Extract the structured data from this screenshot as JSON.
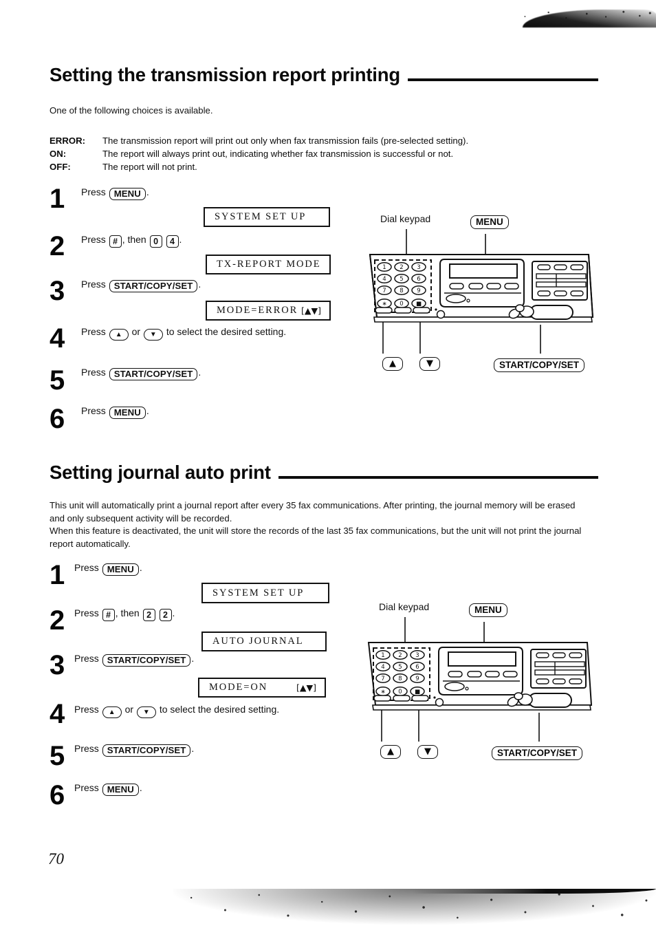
{
  "page": {
    "number": "70"
  },
  "sections": [
    {
      "heading": "Setting the transmission report printing",
      "intro": "One of the following choices is available.",
      "definitions": [
        {
          "term": "ERROR:",
          "desc": "The transmission report will print out only when fax transmission fails (pre-selected setting)."
        },
        {
          "term": "ON:",
          "desc": "The report will always print out, indicating whether fax transmission is successful or not."
        },
        {
          "term": "OFF:",
          "desc": "The report will not print."
        }
      ],
      "steps": [
        {
          "num": "1",
          "press": "Press",
          "key": "MENU",
          "tail": "."
        },
        {
          "num": "2",
          "press": "Press",
          "key": "#",
          "mid": ", then",
          "digits": [
            "0",
            "4"
          ],
          "tail": "."
        },
        {
          "num": "3",
          "press": "Press",
          "key": "START/COPY/SET",
          "tail": "."
        },
        {
          "num": "4",
          "press": "Press",
          "key_up": "▲",
          "or": "or",
          "key_down": "▼",
          "tail": "to select the desired setting."
        },
        {
          "num": "5",
          "press": "Press",
          "key": "START/COPY/SET",
          "tail": "."
        },
        {
          "num": "6",
          "press": "Press",
          "key": "MENU",
          "tail": "."
        }
      ],
      "lcds": [
        {
          "text": "SYSTEM SET UP",
          "arrows": ""
        },
        {
          "text": "TX-REPORT MODE",
          "arrows": ""
        },
        {
          "text": "MODE=ERROR",
          "arrows": "[▲▼]"
        }
      ],
      "diagram": {
        "dial_keypad_label": "Dial keypad",
        "menu_callout": "MENU",
        "start_callout": "START/COPY/SET",
        "up_callout": "▲",
        "down_callout": "▼",
        "keys": [
          "1",
          "2",
          "3",
          "4",
          "5",
          "6",
          "7",
          "8",
          "9",
          "∗",
          "0",
          "■"
        ]
      }
    },
    {
      "heading": "Setting journal auto print",
      "intro": "This unit will automatically print a journal report after every 35 fax communications. After printing, the journal memory will be erased and only subsequent activity will be recorded.\nWhen this feature is deactivated, the unit will store the records of the last 35 fax communications, but the unit will not print the journal report automatically.",
      "steps": [
        {
          "num": "1",
          "press": "Press",
          "key": "MENU",
          "tail": "."
        },
        {
          "num": "2",
          "press": "Press",
          "key": "#",
          "mid": ", then",
          "digits": [
            "2",
            "2"
          ],
          "tail": "."
        },
        {
          "num": "3",
          "press": "Press",
          "key": "START/COPY/SET",
          "tail": "."
        },
        {
          "num": "4",
          "press": "Press",
          "key_up": "▲",
          "or": "or",
          "key_down": "▼",
          "tail": "to select the desired setting."
        },
        {
          "num": "5",
          "press": "Press",
          "key": "START/COPY/SET",
          "tail": "."
        },
        {
          "num": "6",
          "press": "Press",
          "key": "MENU",
          "tail": "."
        }
      ],
      "lcds": [
        {
          "text": "SYSTEM SET UP",
          "arrows": ""
        },
        {
          "text": "AUTO JOURNAL",
          "arrows": ""
        },
        {
          "text": "MODE=ON",
          "arrows": "[▲▼]"
        }
      ],
      "diagram": {
        "dial_keypad_label": "Dial keypad",
        "menu_callout": "MENU",
        "start_callout": "START/COPY/SET",
        "up_callout": "▲",
        "down_callout": "▼",
        "keys": [
          "1",
          "2",
          "3",
          "4",
          "5",
          "6",
          "7",
          "8",
          "9",
          "∗",
          "0",
          "■"
        ]
      }
    }
  ]
}
